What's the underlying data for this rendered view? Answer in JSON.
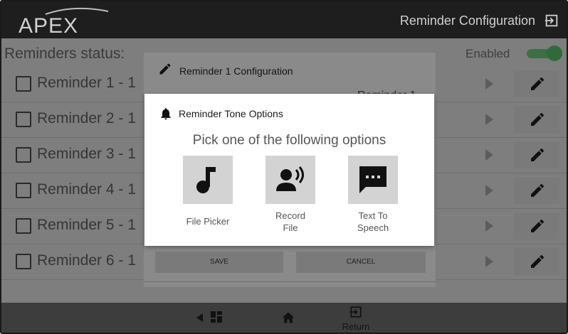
{
  "header": {
    "logo_text": "APEX",
    "title": "Reminder Configuration"
  },
  "list": {
    "status_label": "Reminders status:",
    "enabled_label": "Enabled",
    "reminders": [
      {
        "label": "Reminder 1 - 1"
      },
      {
        "label": "Reminder 2 - 1"
      },
      {
        "label": "Reminder 3 - 1"
      },
      {
        "label": "Reminder 4 - 1"
      },
      {
        "label": "Reminder 5 - 1"
      },
      {
        "label": "Reminder 6 - 1"
      }
    ]
  },
  "config_dialog": {
    "title": "Reminder 1 Configuration",
    "field_value": "Reminder 1",
    "save_label": "SAVE",
    "cancel_label": "CANCEL"
  },
  "tone_modal": {
    "title": "Reminder Tone Options",
    "subtitle": "Pick one of the following options",
    "options": [
      {
        "line1": "File Picker",
        "line2": "",
        "icon": "music-note-icon"
      },
      {
        "line1": "Record",
        "line2": "File",
        "icon": "voice-record-icon"
      },
      {
        "line1": "Text To",
        "line2": "Speech",
        "icon": "chat-bubble-icon"
      }
    ]
  },
  "bottom_nav": {
    "return_label": "Return"
  },
  "colors": {
    "header_bg": "#1e1e1e",
    "overlay_bg": "#7e7e7e",
    "toggle_on": "#2f6b3a",
    "modal_bg": "#ffffff",
    "option_tile": "#d3d3d3"
  }
}
